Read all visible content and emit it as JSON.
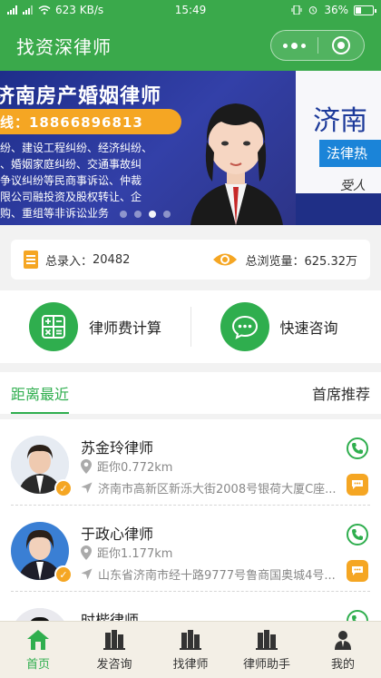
{
  "status_bar": {
    "network_speed": "623 KB/s",
    "time": "15:49",
    "battery": "36%",
    "battery_level": 0.36
  },
  "nav": {
    "title": "找资深律师"
  },
  "banner": {
    "title": "济南房产婚姻律师",
    "phone_line": "线：18866896813",
    "text_lines": [
      "纷、建设工程纠纷、经济纠纷、",
      "、婚姻家庭纠纷、交通事故纠",
      "争议纠纷等民商事诉讼、仲裁",
      "限公司融投资及股权转让、企",
      "购、重组等非诉讼业务"
    ],
    "side_title": "济南",
    "side_tag": "法律热",
    "side_sub": "受人",
    "slides": 4,
    "active_slide": 3
  },
  "stats": {
    "total_label": "总录入：",
    "total_value": "20482",
    "views_label": "总浏览量：",
    "views_value": "625.32万"
  },
  "tools": [
    {
      "label": "律师费计算",
      "icon": "calculator-icon"
    },
    {
      "label": "快速咨询",
      "icon": "chat-bubble-icon"
    }
  ],
  "tabs": {
    "nearest": "距离最近",
    "recommended": "首席推荐"
  },
  "lawyers": [
    {
      "name": "苏金玲律师",
      "distance": "距你0.772km",
      "address": "济南市高新区新泺大街2008号银荷大厦C座..."
    },
    {
      "name": "于政心律师",
      "distance": "距你1.177km",
      "address": "山东省济南市经十路9777号鲁商国奥城4号..."
    },
    {
      "name": "时楷律师",
      "distance": "",
      "address": ""
    }
  ],
  "tabbar": [
    {
      "label": "首页",
      "active": true
    },
    {
      "label": "发咨询",
      "active": false
    },
    {
      "label": "找律师",
      "active": false
    },
    {
      "label": "律师助手",
      "active": false
    },
    {
      "label": "我的",
      "active": false
    }
  ],
  "colors": {
    "brand_green": "#3aa94b",
    "accent_green": "#2fae4e",
    "accent_orange": "#f5a623",
    "banner_blue": "#2a3590"
  }
}
